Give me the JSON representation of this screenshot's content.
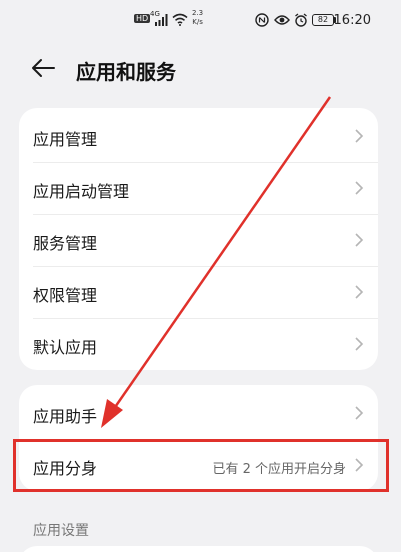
{
  "status_bar": {
    "hd_badge": "HD",
    "network": "4G",
    "speed_top": "2.3",
    "speed_bottom": "K/s",
    "battery": "82",
    "time": "16:20"
  },
  "header": {
    "back_icon": "arrow-left-icon",
    "title": "应用和服务"
  },
  "group_1": [
    {
      "label": "应用管理"
    },
    {
      "label": "应用启动管理"
    },
    {
      "label": "服务管理"
    },
    {
      "label": "权限管理"
    },
    {
      "label": "默认应用"
    }
  ],
  "group_2": [
    {
      "label": "应用助手"
    },
    {
      "label": "应用分身",
      "value": "已有 2 个应用开启分身"
    }
  ],
  "section_label": "应用设置",
  "colors": {
    "annotation_red": "#e0312b",
    "background": "#f1f1f3",
    "card": "#ffffff"
  }
}
